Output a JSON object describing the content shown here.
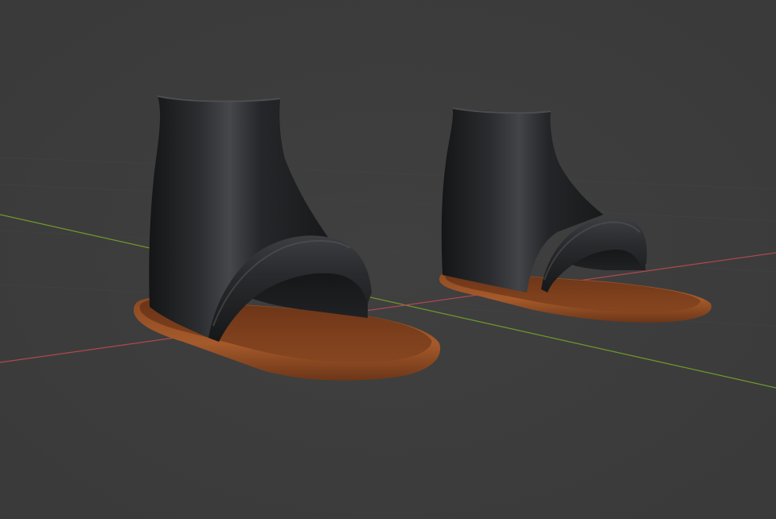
{
  "viewport": {
    "background": "#3d3d3d",
    "axes": {
      "x_axis_color": "#b0494e",
      "y_axis_color": "#6f9a2c"
    },
    "objects": [
      {
        "name": "left-sandal",
        "upper_color": "#1e1f21",
        "sole_color": "#7e3f1c"
      },
      {
        "name": "right-sandal",
        "upper_color": "#1e1f21",
        "sole_color": "#7e3f1c"
      }
    ]
  }
}
